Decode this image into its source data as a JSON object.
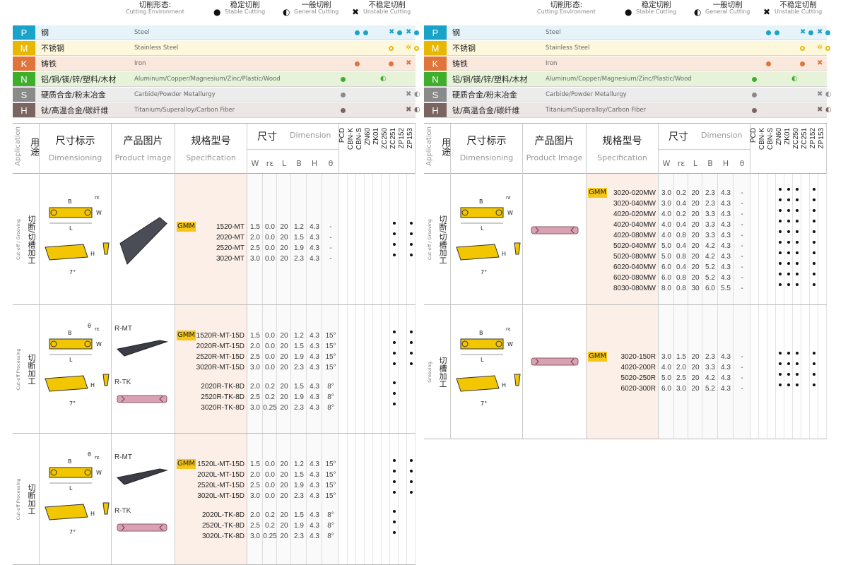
{
  "legend": {
    "env_zh": "切削形态:",
    "env_en": "Cutting Environment",
    "stable_zh": "稳定切削",
    "stable_en": "Stable Cutting",
    "general_zh": "一般切削",
    "general_en": "General Cutting",
    "unstable_zh": "不稳定切削",
    "unstable_en": "Unstable Cutting",
    "stable_icon": "●",
    "general_icon": "◐",
    "unstable_icon": "✖"
  },
  "materials": [
    {
      "letter": "P",
      "zh": "钢",
      "en": "Steel",
      "color": "#1aa3c8",
      "bg": "#e6f4fa"
    },
    {
      "letter": "M",
      "zh": "不锈钢",
      "en": "Stainless Steel",
      "color": "#e8b800",
      "bg": "#fdf7dc"
    },
    {
      "letter": "K",
      "zh": "铸铁",
      "en": "Iron",
      "color": "#e0743a",
      "bg": "#fbe8dd"
    },
    {
      "letter": "N",
      "zh": "铝/铜/镁/锌/塑料/木材",
      "en": "Aluminum/Copper/Magnesium/Zinc/Plastic/Wood",
      "color": "#3fae2a",
      "bg": "#e6f3d9"
    },
    {
      "letter": "S",
      "zh": "硬质合金/粉末冶金",
      "en": "Carbide/Powder Metallurgy",
      "color": "#8a8a8a",
      "bg": "#ececec"
    },
    {
      "letter": "H",
      "zh": "钛/高温合金/碳纤维",
      "en": "Titanium/Superalloy/Carbon Fiber",
      "color": "#7a6560",
      "bg": "#ece6e4"
    }
  ],
  "header": {
    "app_zh": "用途",
    "app_en": "Application",
    "dim_zh": "尺寸标示",
    "dim_en": "Dimensioning",
    "img_zh": "产品图片",
    "img_en": "Product Image",
    "spec_zh": "规格型号",
    "spec_en": "Specification",
    "size_zh": "尺寸",
    "size_en": "Dimension",
    "dims": [
      "W",
      "rε",
      "L",
      "B",
      "H",
      "θ"
    ],
    "grades": [
      "PCD",
      "CBN-K",
      "CBN-S",
      "ZN60",
      "ZK01",
      "ZC250",
      "ZC251",
      "ZP152",
      "ZP153"
    ]
  },
  "left": {
    "sections": [
      {
        "app_zh": "切断/切槽加工",
        "app_en": "Cut-off / Grooving",
        "prefix": "GMM",
        "rows": [
          {
            "spec": "1520-MT",
            "v": [
              "1.5",
              "0.0",
              "20",
              "1.2",
              "4.3",
              "-"
            ],
            "g": [
              6,
              8
            ]
          },
          {
            "spec": "2020-MT",
            "v": [
              "2.0",
              "0.0",
              "20",
              "1.5",
              "4.3",
              "-"
            ],
            "g": [
              6,
              8
            ]
          },
          {
            "spec": "2520-MT",
            "v": [
              "2.5",
              "0.0",
              "20",
              "1.9",
              "4.3",
              "-"
            ],
            "g": [
              6,
              8
            ]
          },
          {
            "spec": "3020-MT",
            "v": [
              "3.0",
              "0.0",
              "20",
              "2.3",
              "4.3",
              "-"
            ],
            "g": [
              6,
              8
            ]
          }
        ]
      },
      {
        "app_zh": "切断加工",
        "app_en": "Cut-off Processing",
        "prefix": "GMM",
        "label1": "R-MT",
        "label2": "R-TK",
        "rows": [
          {
            "spec": "1520R-MT-15D",
            "v": [
              "1.5",
              "0.0",
              "20",
              "1.2",
              "4.3",
              "15°"
            ],
            "g": [
              6,
              8
            ]
          },
          {
            "spec": "2020R-MT-15D",
            "v": [
              "2.0",
              "0.0",
              "20",
              "1.5",
              "4.3",
              "15°"
            ],
            "g": [
              6,
              8
            ]
          },
          {
            "spec": "2520R-MT-15D",
            "v": [
              "2.5",
              "0.0",
              "20",
              "1.9",
              "4.3",
              "15°"
            ],
            "g": [
              6,
              8
            ]
          },
          {
            "spec": "3020R-MT-15D",
            "v": [
              "3.0",
              "0.0",
              "20",
              "2.3",
              "4.3",
              "15°"
            ],
            "g": [
              6,
              8
            ]
          },
          {
            "spec": "2020R-TK-8D",
            "v": [
              "2.0",
              "0.2",
              "20",
              "1.5",
              "4.3",
              "8°"
            ],
            "g": [
              6
            ]
          },
          {
            "spec": "2520R-TK-8D",
            "v": [
              "2.5",
              "0.2",
              "20",
              "1.9",
              "4.3",
              "8°"
            ],
            "g": [
              6
            ]
          },
          {
            "spec": "3020R-TK-8D",
            "v": [
              "3.0",
              "0.25",
              "20",
              "2.3",
              "4.3",
              "8°"
            ],
            "g": [
              6
            ]
          }
        ]
      },
      {
        "app_zh": "切断加工",
        "app_en": "Cut-off Processing",
        "prefix": "GMM",
        "label1": "R-MT",
        "label2": "R-TK",
        "rows": [
          {
            "spec": "1520L-MT-15D",
            "v": [
              "1.5",
              "0.0",
              "20",
              "1.2",
              "4.3",
              "15°"
            ],
            "g": [
              6,
              8
            ]
          },
          {
            "spec": "2020L-MT-15D",
            "v": [
              "2.0",
              "0.0",
              "20",
              "1.5",
              "4.3",
              "15°"
            ],
            "g": [
              6,
              8
            ]
          },
          {
            "spec": "2520L-MT-15D",
            "v": [
              "2.5",
              "0.0",
              "20",
              "1.9",
              "4.3",
              "15°"
            ],
            "g": [
              6,
              8
            ]
          },
          {
            "spec": "3020L-MT-15D",
            "v": [
              "3.0",
              "0.0",
              "20",
              "2.3",
              "4.3",
              "15°"
            ],
            "g": [
              6,
              8
            ]
          },
          {
            "spec": "2020L-TK-8D",
            "v": [
              "2.0",
              "0.2",
              "20",
              "1.5",
              "4.3",
              "8°"
            ],
            "g": [
              6
            ]
          },
          {
            "spec": "2520L-TK-8D",
            "v": [
              "2.5",
              "0.2",
              "20",
              "1.9",
              "4.3",
              "8°"
            ],
            "g": [
              6
            ]
          },
          {
            "spec": "3020L-TK-8D",
            "v": [
              "3.0",
              "0.25",
              "20",
              "2.3",
              "4.3",
              "8°"
            ],
            "g": [
              6
            ]
          }
        ]
      }
    ]
  },
  "right": {
    "sections": [
      {
        "app_zh": "切断/切槽加工",
        "app_en": "Cut-off / Grooving",
        "prefix": "GMM",
        "rows": [
          {
            "spec": "3020-020MW",
            "v": [
              "3.0",
              "0.2",
              "20",
              "2.3",
              "4.3",
              "-"
            ],
            "g": [
              3,
              4,
              5,
              7
            ]
          },
          {
            "spec": "3020-040MW",
            "v": [
              "3.0",
              "0.4",
              "20",
              "2.3",
              "4.3",
              "-"
            ],
            "g": [
              3,
              4,
              5,
              7
            ]
          },
          {
            "spec": "4020-020MW",
            "v": [
              "4.0",
              "0.2",
              "20",
              "3.3",
              "4.3",
              "-"
            ],
            "g": [
              3,
              4,
              5,
              7
            ]
          },
          {
            "spec": "4020-040MW",
            "v": [
              "4.0",
              "0.4",
              "20",
              "3.3",
              "4.3",
              "-"
            ],
            "g": [
              3,
              4,
              5,
              7
            ]
          },
          {
            "spec": "4020-080MW",
            "v": [
              "4.0",
              "0.8",
              "20",
              "3.3",
              "4.3",
              "-"
            ],
            "g": [
              3,
              4,
              5,
              7
            ]
          },
          {
            "spec": "5020-040MW",
            "v": [
              "5.0",
              "0.4",
              "20",
              "4.2",
              "4.3",
              "-"
            ],
            "g": [
              3,
              4,
              5,
              7
            ]
          },
          {
            "spec": "5020-080MW",
            "v": [
              "5.0",
              "0.8",
              "20",
              "4.2",
              "4.3",
              "-"
            ],
            "g": [
              3,
              4,
              5,
              7
            ]
          },
          {
            "spec": "6020-040MW",
            "v": [
              "6.0",
              "0.4",
              "20",
              "5.2",
              "4.3",
              "-"
            ],
            "g": [
              3,
              4,
              5,
              7
            ]
          },
          {
            "spec": "6020-080MW",
            "v": [
              "6.0",
              "0.8",
              "20",
              "5.2",
              "4.3",
              "-"
            ],
            "g": [
              3,
              4,
              5,
              7
            ]
          },
          {
            "spec": "8030-080MW",
            "v": [
              "8.0",
              "0.8",
              "30",
              "6.0",
              "5.5",
              "-"
            ],
            "g": [
              3,
              4,
              5,
              7
            ]
          }
        ]
      },
      {
        "app_zh": "切槽加工",
        "app_en": "Grooving",
        "prefix": "GMM",
        "rows": [
          {
            "spec": "3020-150R",
            "v": [
              "3.0",
              "1.5",
              "20",
              "2.3",
              "4.3",
              "-"
            ],
            "g": [
              3,
              4,
              5,
              7
            ]
          },
          {
            "spec": "4020-200R",
            "v": [
              "4.0",
              "2.0",
              "20",
              "3.3",
              "4.3",
              "-"
            ],
            "g": [
              3,
              4,
              5,
              7
            ]
          },
          {
            "spec": "5020-250R",
            "v": [
              "5.0",
              "2.5",
              "20",
              "4.2",
              "4.3",
              "-"
            ],
            "g": [
              3,
              4,
              5,
              7
            ]
          },
          {
            "spec": "6020-300R",
            "v": [
              "6.0",
              "3.0",
              "20",
              "5.2",
              "4.3",
              "-"
            ],
            "g": [
              3,
              4,
              5,
              7
            ]
          }
        ]
      }
    ]
  },
  "dim_symbols": {
    "B": "B",
    "L": "L",
    "W": "W",
    "H": "H",
    "re": "rε",
    "theta": "θ",
    "angle7": "7°"
  }
}
